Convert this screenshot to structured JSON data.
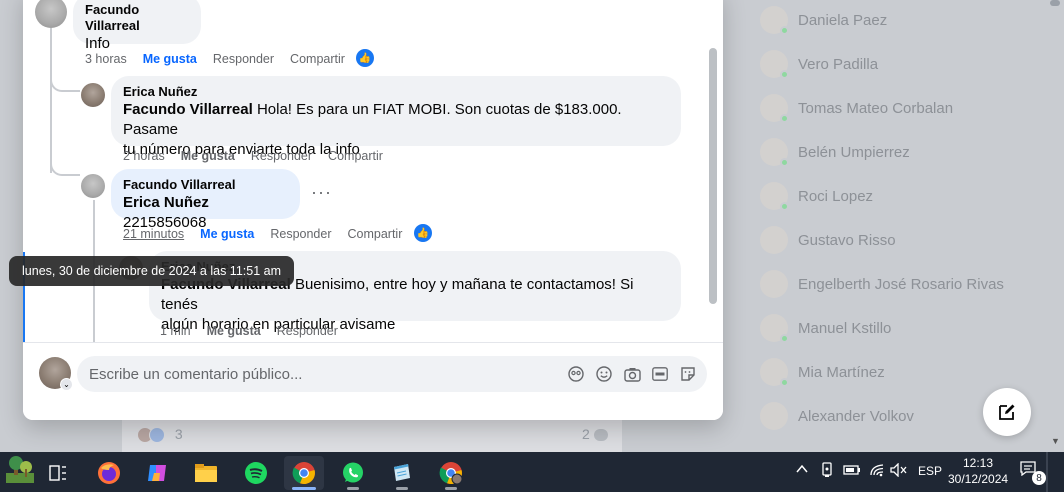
{
  "thread": {
    "c1": {
      "author": "Facundo Villarreal",
      "text": "Info",
      "time": "3 horas",
      "like": "Me gusta",
      "reply": "Responder",
      "share": "Compartir"
    },
    "c2": {
      "author": "Erica Nuñez",
      "mention": "Facundo Villarreal",
      "text": "Hola! Es para un FIAT MOBI. Son cuotas de $183.000. Pasame",
      "text2": "tu número para enviarte toda la info",
      "time": "2 horas",
      "like": "Me gusta",
      "reply": "Responder",
      "share": "Compartir"
    },
    "c3": {
      "author": "Facundo Villarreal",
      "mention": "Erica Nuñez",
      "text": "2215856068",
      "more": "···",
      "time": "21 minutos",
      "like": "Me gusta",
      "reply": "Responder",
      "share": "Compartir"
    },
    "c4": {
      "author": "Erica Nuñez",
      "mention": "Facundo Villarreal",
      "text": "Buenisimo, entre hoy y mañana te contactamos! Si tenés",
      "text2": "algún horario en particular avisame",
      "time": "1 min",
      "like": "Me gusta",
      "reply": "Responder"
    }
  },
  "tooltip": "lunes, 30 de diciembre de 2024 a las 11:51 am",
  "composer": {
    "placeholder": "Escribe un comentario público..."
  },
  "below": {
    "reaction_count": "3",
    "comment_count": "2"
  },
  "contacts": [
    "Daniela Paez",
    "Vero Padilla",
    "Tomas Mateo Corbalan",
    "Belén Umpierrez",
    "Roci Lopez",
    "Gustavo Risso",
    "Engelberth José Rosario Rivas",
    "Manuel Kstillo",
    "Mia Martínez",
    "Alexander Volkov"
  ],
  "taskbar": {
    "language": "ESP",
    "time": "12:13",
    "date": "30/12/2024",
    "notifications": "8"
  },
  "colors": {
    "accent": "#0866ff",
    "like_badge": "#1877f2",
    "taskbar": "#1f2734"
  }
}
